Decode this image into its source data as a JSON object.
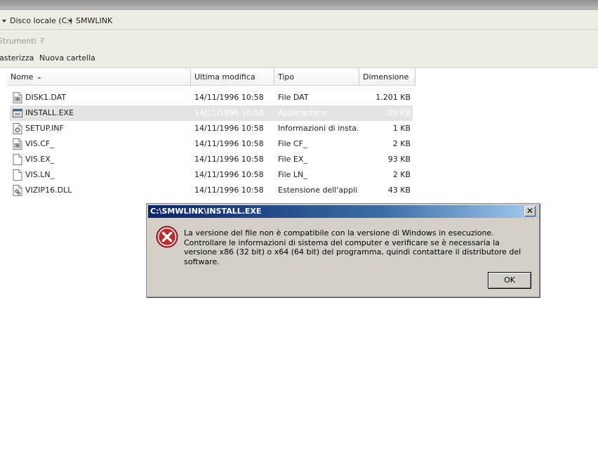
{
  "address": {
    "segments": [
      "Disco locale (C:)",
      "SMWLINK"
    ]
  },
  "menu": {
    "tools": "Strumenti",
    "help": "?"
  },
  "toolbar": {
    "rasterize": "asterizza",
    "new_folder": "Nuova cartella"
  },
  "columns": {
    "name": "Nome",
    "modified": "Ultima modifica",
    "type": "Tipo",
    "size": "Dimensione"
  },
  "files": [
    {
      "name": "DISK1.DAT",
      "modified": "14/11/1996 10:58",
      "type": "File DAT",
      "size": "1.201 KB",
      "icon": "generic-file-icon"
    },
    {
      "name": "INSTALL.EXE",
      "modified": "14/11/1996 10:58",
      "type": "Applicazione",
      "size": "20 KB",
      "icon": "application-icon"
    },
    {
      "name": "SETUP.INF",
      "modified": "14/11/1996 10:58",
      "type": "Informazioni di insta...",
      "size": "1 KB",
      "icon": "settings-file-icon"
    },
    {
      "name": "VIS.CF_",
      "modified": "14/11/1996 10:58",
      "type": "File CF_",
      "size": "2 KB",
      "icon": "generic-file-icon"
    },
    {
      "name": "VIS.EX_",
      "modified": "14/11/1996 10:58",
      "type": "File EX_",
      "size": "93 KB",
      "icon": "blank-file-icon"
    },
    {
      "name": "VIS.LN_",
      "modified": "14/11/1996 10:58",
      "type": "File LN_",
      "size": "2 KB",
      "icon": "blank-file-icon"
    },
    {
      "name": "VIZIP16.DLL",
      "modified": "14/11/1996 10:58",
      "type": "Estensione dell'appli...",
      "size": "43 KB",
      "icon": "dll-file-icon"
    }
  ],
  "dialog": {
    "title": "C:\\SMWLINK\\INSTALL.EXE",
    "message": "La versione del file non è compatibile con la versione di Windows in esecuzione. Controllare le informazioni di sistema del computer e verificare se è necessaria la versione x86 (32 bit) o x64 (64 bit) del programma, quindi contattare il distributore del software.",
    "ok_label": "OK",
    "close_glyph": "✕",
    "icon": "error-icon"
  }
}
